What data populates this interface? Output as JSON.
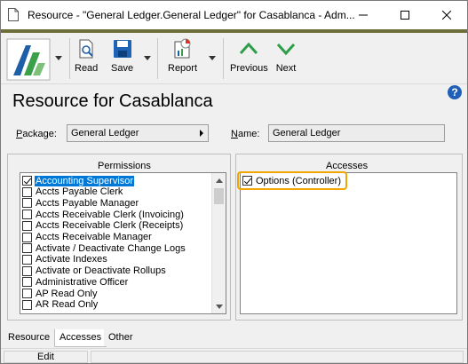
{
  "window": {
    "title": "Resource - \"General Ledger.General Ledger\" for Casablanca - Adm..."
  },
  "toolbar": {
    "read_label": "Read",
    "save_label": "Save",
    "report_label": "Report",
    "previous_label": "Previous",
    "next_label": "Next"
  },
  "page": {
    "title": "Resource for Casablanca",
    "help": "?"
  },
  "fields": {
    "package_label_prefix": "P",
    "package_label_rest": "ackage:",
    "package_value": "General Ledger",
    "name_label_prefix": "N",
    "name_label_rest": "ame:",
    "name_value": "General Ledger"
  },
  "permissions": {
    "title": "Permissions",
    "items": [
      {
        "label": "Accounting Supervisor",
        "checked": true,
        "selected": true
      },
      {
        "label": "Accts Payable Clerk",
        "checked": false
      },
      {
        "label": "Accts Payable Manager",
        "checked": false
      },
      {
        "label": "Accts Receivable Clerk (Invoicing)",
        "checked": false
      },
      {
        "label": "Accts Receivable Clerk (Receipts)",
        "checked": false
      },
      {
        "label": "Accts Receivable Manager",
        "checked": false
      },
      {
        "label": "Activate / Deactivate Change Logs",
        "checked": false
      },
      {
        "label": "Activate Indexes",
        "checked": false
      },
      {
        "label": "Activate or Deactivate Rollups",
        "checked": false
      },
      {
        "label": "Administrative Officer",
        "checked": false
      },
      {
        "label": "AP Read Only",
        "checked": false
      },
      {
        "label": "AR Read Only",
        "checked": false
      }
    ]
  },
  "accesses": {
    "title": "Accesses",
    "items": [
      {
        "label": "Options (Controller)",
        "checked": true
      }
    ]
  },
  "tabs": [
    {
      "label": "Resource",
      "active": false
    },
    {
      "label": "Accesses",
      "active": true
    },
    {
      "label": "Other",
      "active": false
    }
  ],
  "status": {
    "mode": "Edit"
  },
  "colors": {
    "accent_olive": "#6e6e3a",
    "selection": "#0078d7",
    "highlight_border": "#f0a500",
    "arrow_green": "#2e9e4a"
  }
}
